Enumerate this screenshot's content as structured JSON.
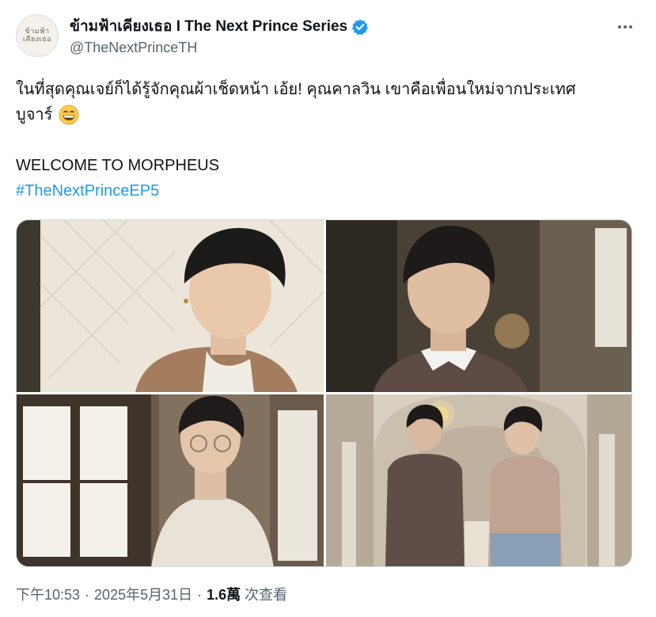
{
  "tweet": {
    "avatar_text": "ข้ามฟ้า\nเคียงเธอ",
    "display_name": "ข้ามฟ้าเคียงเธอ I The Next Prince Series",
    "handle": "@TheNextPrinceTH",
    "verified_color": "#1d9bf0",
    "body_line1": "ในที่สุดคุณเจย์ก็ได้รู้จักคุณผ้าเช็ดหน้า เอ้ย! คุณคาลวิน เขาคือเพื่อนใหม่จากประเทศ",
    "body_line2": "บูจาร์",
    "emoji": "grinning-face",
    "body_line3": "WELCOME TO MORPHEUS",
    "hashtag": "#TheNextPrinceEP5",
    "hashtag_color": "#1d9bf0"
  },
  "media": {
    "photos": [
      {
        "name": "photo-1",
        "icon": "portrait-beige-jacket"
      },
      {
        "name": "photo-2",
        "icon": "portrait-brown-sweater"
      },
      {
        "name": "photo-3",
        "icon": "portrait-glasses-shirt"
      },
      {
        "name": "photo-4",
        "icon": "two-men-hallway"
      }
    ]
  },
  "footer": {
    "time": "下午10:53",
    "separator": "·",
    "date": "2025年5月31日",
    "views_count": "1.6萬",
    "views_label": "次查看"
  }
}
